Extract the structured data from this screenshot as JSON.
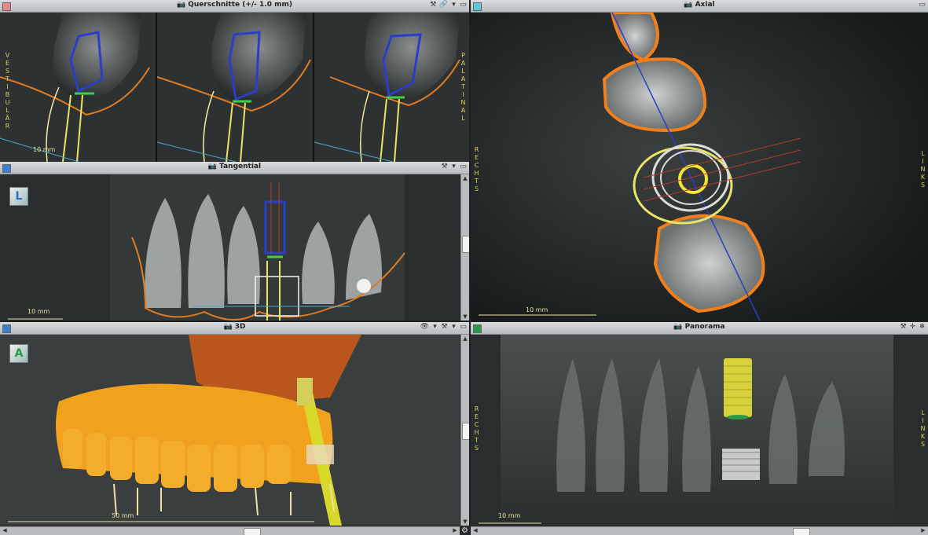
{
  "panels": {
    "cross": {
      "title": "Querschnitte (+/- 1.0 mm)",
      "swatch": "#e08a8a",
      "label_left": "VESTIBULÄR",
      "label_right": "PALATINAL",
      "scale": "10 mm"
    },
    "axial": {
      "title": "Axial",
      "swatch": "#5bc8d8",
      "label_left": "RECHTS",
      "label_right": "LINKS",
      "scale": "10 mm"
    },
    "tangential": {
      "title": "Tangential",
      "swatch": "#3a7fd0",
      "orient": "L",
      "scale": "10 mm"
    },
    "threed": {
      "title": "3D",
      "swatch": "#3a7fd0",
      "orient": "A",
      "scale": "50 mm"
    },
    "panorama": {
      "title": "Panorama",
      "swatch": "#2a9a4a",
      "label_left": "RECHTS",
      "label_right": "LINKS",
      "scale": "10 mm"
    }
  },
  "icons": {
    "camera": "📷",
    "tools": "⚒",
    "dropdown": "▾",
    "link": "🔗",
    "maximize": "▭",
    "eye": "👁",
    "settings": "⚙",
    "arrow_up": "▲",
    "arrow_down": "▼",
    "arrow_left": "◀",
    "arrow_right": "▶",
    "crosshair": "✛",
    "snow": "❄"
  }
}
